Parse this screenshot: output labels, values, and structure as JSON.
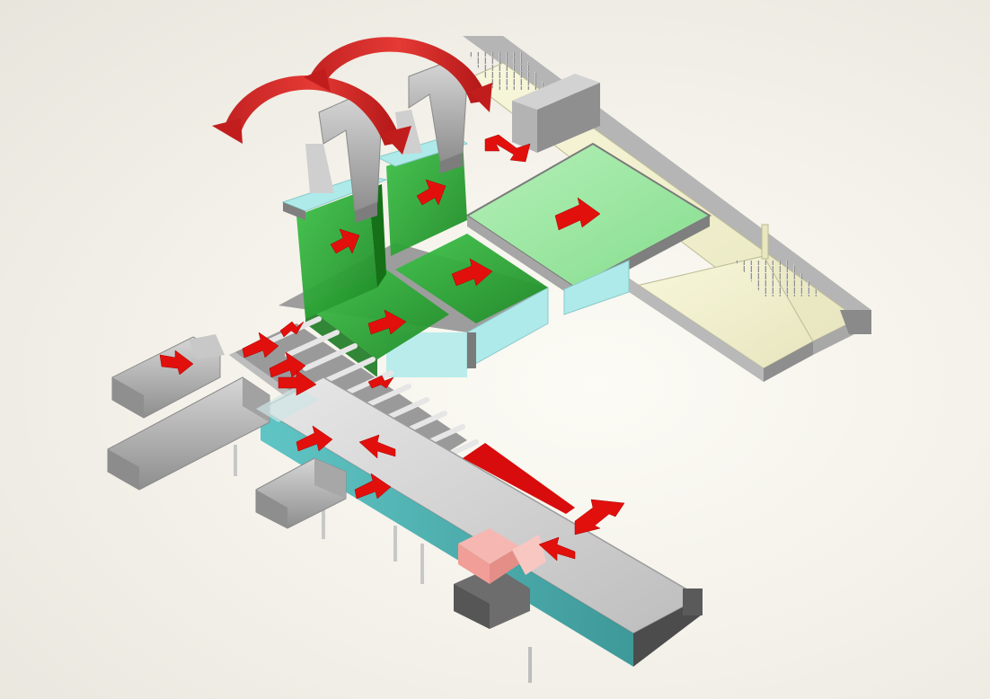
{
  "colors": {
    "background": "#f3f1e9",
    "panel_green": "#2ea836",
    "panel_green_light": "#98e6a0",
    "frame_gray": "#a7a7a7",
    "frame_dark": "#7d7d7d",
    "accent_cyan": "#aeeaea",
    "belt_teal": "#3aa9a9",
    "table_cream": "#f1f0cd",
    "arrow_red": "#e2100c",
    "product_pink": "#f4a9a4"
  },
  "icons": {
    "motion_arrow": "red-arrow-icon",
    "swing_arrow": "curved-arrow-icon",
    "double_arrow": "double-arrow-icon"
  }
}
